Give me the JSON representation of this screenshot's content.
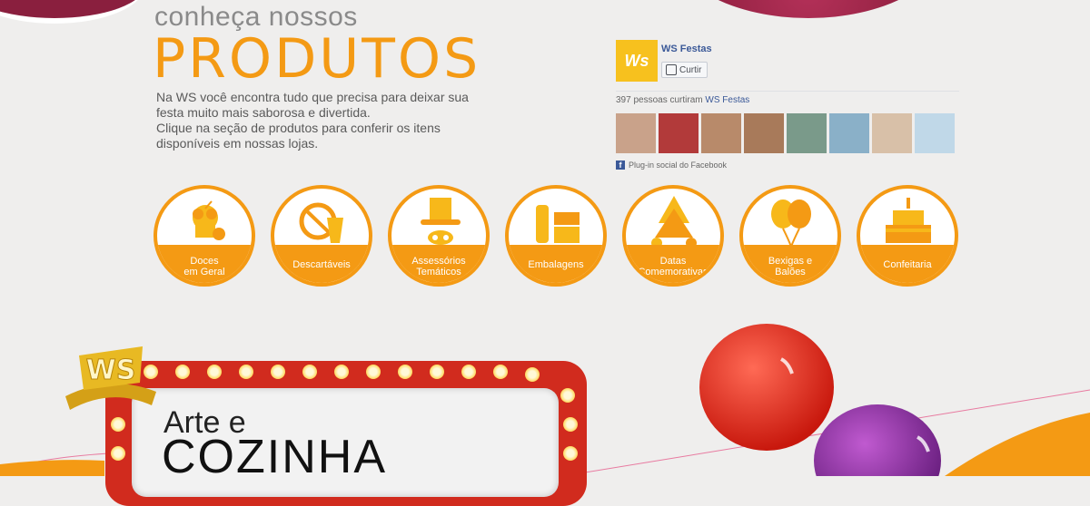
{
  "header": {
    "subtitle": "conheça nossos",
    "title": "PRODUTOS",
    "intro_lines": [
      "Na WS você encontra tudo que precisa para deixar sua",
      "festa muito mais saborosa e divertida.",
      "Clique na seção de produtos para conferir os itens",
      "disponíveis em nossas lojas."
    ]
  },
  "facebook": {
    "logo_text": "Ws",
    "page_name": "WS Festas",
    "like_label": "Curtir",
    "count_text": "397 pessoas curtiram",
    "count_link": "WS Festas",
    "plugin_text": "Plug-in social do Facebook",
    "face_colors": [
      "#c9a28a",
      "#b23a3a",
      "#b88a6a",
      "#a87a5a",
      "#7a9a8a",
      "#8ab0c8",
      "#d8c0a8",
      "#c0d8e8"
    ]
  },
  "categories": [
    {
      "line1": "Doces",
      "line2": "em Geral",
      "icon": "cupcake-icon"
    },
    {
      "line1": "Descartáveis",
      "line2": "",
      "icon": "disposable-cup-icon"
    },
    {
      "line1": "Assessórios",
      "line2": "Temáticos",
      "icon": "hat-mask-icon"
    },
    {
      "line1": "Embalagens",
      "line2": "",
      "icon": "packaging-icon"
    },
    {
      "line1": "Datas",
      "line2": "Comemorativas",
      "icon": "christmas-tree-icon"
    },
    {
      "line1": "Bexigas e",
      "line2": "Balões",
      "icon": "balloons-icon"
    },
    {
      "line1": "Confeitaria",
      "line2": "",
      "icon": "cake-icon"
    }
  ],
  "promo": {
    "badge": "WS",
    "line1": "Arte e",
    "line2": "COZINHA"
  },
  "colors": {
    "accent": "#f49a14",
    "wine": "#8a1f3e",
    "facebook": "#3b5998"
  }
}
